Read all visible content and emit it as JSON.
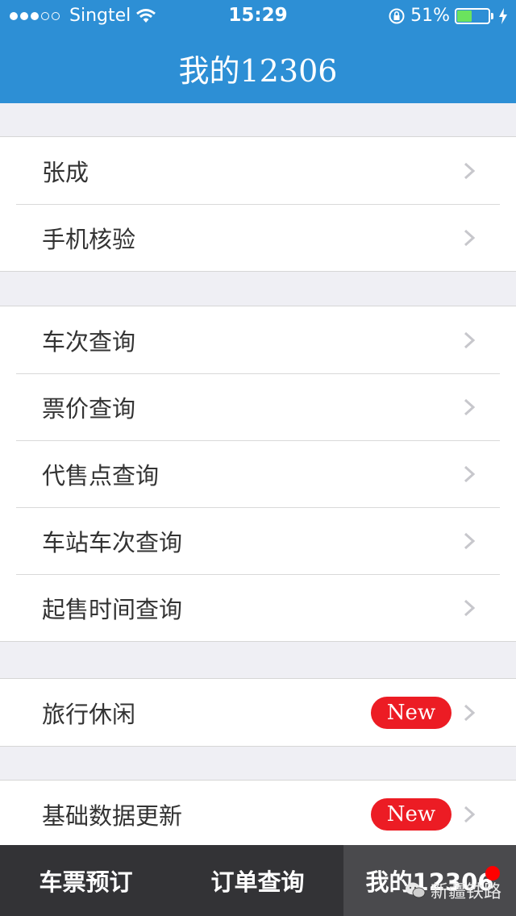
{
  "status_bar": {
    "carrier": "Singtel",
    "signal_bars_filled": 3,
    "signal_bars_total": 5,
    "time": "15:29",
    "battery_percent": "51%",
    "battery_level": 0.51
  },
  "header": {
    "title": "我的12306"
  },
  "sections": [
    {
      "items": [
        {
          "label": "张成"
        },
        {
          "label": "手机核验"
        }
      ]
    },
    {
      "items": [
        {
          "label": "车次查询"
        },
        {
          "label": "票价查询"
        },
        {
          "label": "代售点查询"
        },
        {
          "label": "车站车次查询"
        },
        {
          "label": "起售时间查询"
        }
      ]
    },
    {
      "items": [
        {
          "label": "旅行休闲",
          "badge": "New"
        }
      ]
    },
    {
      "items": [
        {
          "label": "基础数据更新",
          "badge": "New"
        }
      ]
    }
  ],
  "tab_bar": {
    "tabs": [
      {
        "label": "车票预订",
        "active": false
      },
      {
        "label": "订单查询",
        "active": false
      },
      {
        "label": "我的12306",
        "active": true,
        "has_dot": true
      }
    ]
  },
  "watermark": {
    "text": "新疆铁路"
  },
  "colors": {
    "nav_blue": "#2d8fd5",
    "badge_red": "#ec1c24",
    "tab_bar": "#333336",
    "tab_active": "#4a4a4d"
  }
}
